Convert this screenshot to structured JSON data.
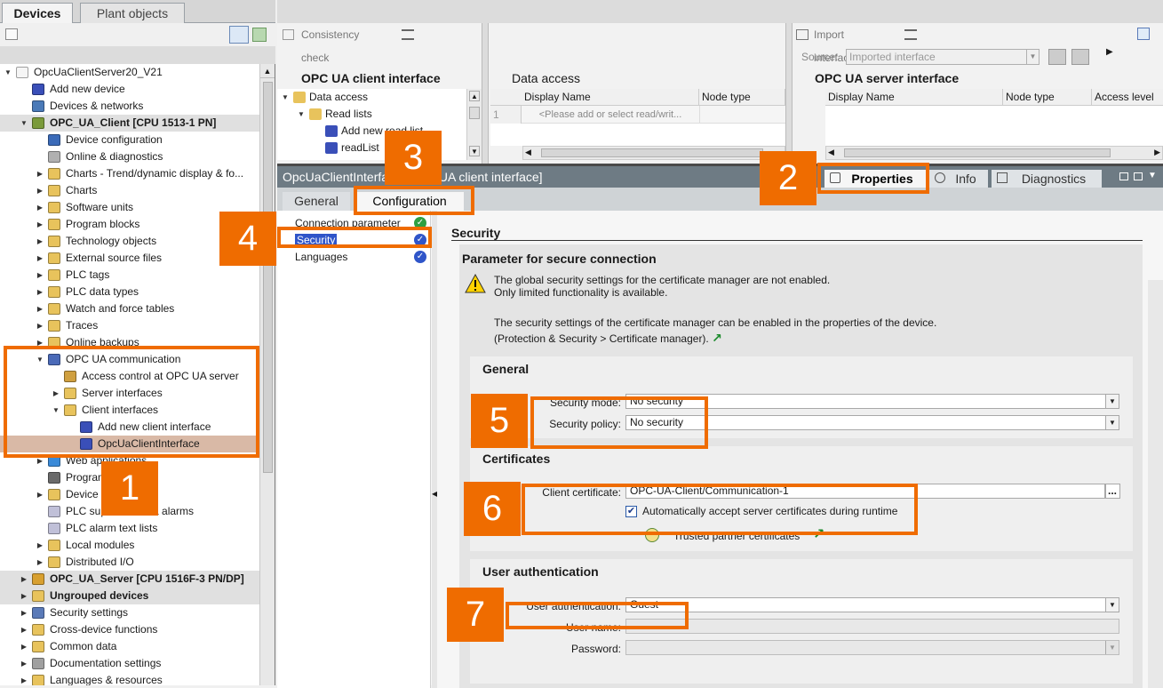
{
  "left_panel": {
    "tabs": [
      "Devices",
      "Plant objects"
    ],
    "tree": [
      {
        "label": "OpcUaClientServer20_V21",
        "indent": 0,
        "state": "open",
        "icon": "project-icon",
        "color": "#f5f5f5"
      },
      {
        "label": "Add new device",
        "indent": 1,
        "state": "none",
        "icon": "add-device-icon",
        "color": "#3a4fb8"
      },
      {
        "label": "Devices & networks",
        "indent": 1,
        "state": "none",
        "icon": "network-icon",
        "color": "#4a7ab8"
      },
      {
        "label": "OPC_UA_Client [CPU 1513-1 PN]",
        "indent": 1,
        "state": "open",
        "icon": "plc-icon",
        "color": "#7a9a3a",
        "band": true
      },
      {
        "label": "Device configuration",
        "indent": 2,
        "state": "none",
        "icon": "device-config-icon",
        "color": "#3a6ab8"
      },
      {
        "label": "Online & diagnostics",
        "indent": 2,
        "state": "none",
        "icon": "online-diagnostics-icon",
        "color": "#b0b0b0"
      },
      {
        "label": "Charts - Trend/dynamic display & fo...",
        "indent": 2,
        "state": "closed",
        "icon": "folder-icon",
        "color": "#e8c35c"
      },
      {
        "label": "Charts",
        "indent": 2,
        "state": "closed",
        "icon": "folder-icon",
        "color": "#e8c35c"
      },
      {
        "label": "Software units",
        "indent": 2,
        "state": "closed",
        "icon": "folder-icon",
        "color": "#e8c35c"
      },
      {
        "label": "Program blocks",
        "indent": 2,
        "state": "closed",
        "icon": "folder-icon",
        "color": "#e8c35c"
      },
      {
        "label": "Technology objects",
        "indent": 2,
        "state": "closed",
        "icon": "folder-icon",
        "color": "#e8c35c"
      },
      {
        "label": "External source files",
        "indent": 2,
        "state": "closed",
        "icon": "folder-icon",
        "color": "#e8c35c"
      },
      {
        "label": "PLC tags",
        "indent": 2,
        "state": "closed",
        "icon": "folder-icon",
        "color": "#e8c35c"
      },
      {
        "label": "PLC data types",
        "indent": 2,
        "state": "closed",
        "icon": "folder-icon",
        "color": "#e8c35c"
      },
      {
        "label": "Watch and force tables",
        "indent": 2,
        "state": "closed",
        "icon": "folder-icon",
        "color": "#e8c35c"
      },
      {
        "label": "Traces",
        "indent": 2,
        "state": "closed",
        "icon": "folder-icon",
        "color": "#e8c35c"
      },
      {
        "label": "Online backups",
        "indent": 2,
        "state": "closed",
        "icon": "folder-icon",
        "color": "#e8c35c"
      },
      {
        "label": "OPC UA communication",
        "indent": 2,
        "state": "open",
        "icon": "opc-ua-icon",
        "color": "#4a6ab8"
      },
      {
        "label": "Access control at OPC UA server",
        "indent": 3,
        "state": "none",
        "icon": "users-icon",
        "color": "#d0a040"
      },
      {
        "label": "Server interfaces",
        "indent": 3,
        "state": "closed",
        "icon": "folder-icon",
        "color": "#e8c35c"
      },
      {
        "label": "Client interfaces",
        "indent": 3,
        "state": "open",
        "icon": "folder-icon",
        "color": "#e8c35c"
      },
      {
        "label": "Add new client interface",
        "indent": 4,
        "state": "none",
        "icon": "add-interface-icon",
        "color": "#3a4fb8"
      },
      {
        "label": "OpcUaClientInterface",
        "indent": 4,
        "state": "none",
        "icon": "interface-icon",
        "color": "#3a4fb8",
        "selected": true
      },
      {
        "label": "Web applications",
        "indent": 2,
        "state": "closed",
        "icon": "web-icon",
        "color": "#3a8ad8"
      },
      {
        "label": "Program info",
        "indent": 2,
        "state": "none",
        "icon": "program-info-icon",
        "color": "#6a6a6a"
      },
      {
        "label": "Device proxy data",
        "indent": 2,
        "state": "closed",
        "icon": "folder-icon",
        "color": "#e8c35c"
      },
      {
        "label": "PLC supervisions & alarms",
        "indent": 2,
        "state": "none",
        "icon": "alarm-icon",
        "color": "#c0c0d8"
      },
      {
        "label": "PLC alarm text lists",
        "indent": 2,
        "state": "none",
        "icon": "text-list-icon",
        "color": "#c0c0d8"
      },
      {
        "label": "Local modules",
        "indent": 2,
        "state": "closed",
        "icon": "folder-icon",
        "color": "#e8c35c"
      },
      {
        "label": "Distributed I/O",
        "indent": 2,
        "state": "closed",
        "icon": "folder-icon",
        "color": "#e8c35c"
      },
      {
        "label": "OPC_UA_Server [CPU 1516F-3 PN/DP]",
        "indent": 1,
        "state": "closed",
        "icon": "plc-icon",
        "color": "#d8a030",
        "band": true
      },
      {
        "label": "Ungrouped devices",
        "indent": 1,
        "state": "closed",
        "icon": "folder-icon",
        "color": "#e8c35c",
        "band": true
      },
      {
        "label": "Security settings",
        "indent": 1,
        "state": "closed",
        "icon": "security-icon",
        "color": "#5a7ab8"
      },
      {
        "label": "Cross-device functions",
        "indent": 1,
        "state": "closed",
        "icon": "folder-icon",
        "color": "#e8c35c"
      },
      {
        "label": "Common data",
        "indent": 1,
        "state": "closed",
        "icon": "folder-icon",
        "color": "#e8c35c"
      },
      {
        "label": "Documentation settings",
        "indent": 1,
        "state": "closed",
        "icon": "doc-icon",
        "color": "#a0a0a0"
      },
      {
        "label": "Languages & resources",
        "indent": 1,
        "state": "closed",
        "icon": "folder-icon",
        "color": "#e8c35c"
      }
    ]
  },
  "editor": {
    "consistency_check": "Consistency check",
    "import_interface": "Import interface",
    "source_label": "Source:",
    "source_value": "Imported interface",
    "client_interface_title": "OPC UA client interface",
    "data_access_title": "Data access",
    "server_interface_title": "OPC UA server interface",
    "client_tree": [
      {
        "label": "Data access",
        "indent": 0
      },
      {
        "label": "Read lists",
        "indent": 1
      },
      {
        "label": "Add new read list",
        "indent": 2
      },
      {
        "label": "readList",
        "indent": 2
      }
    ],
    "data_access_columns": [
      "Display Name",
      "Node type"
    ],
    "data_access_row_index": "1",
    "data_access_placeholder": "<Please add or select read/writ...",
    "server_columns": [
      "Display Name",
      "Node type",
      "Access level"
    ]
  },
  "properties": {
    "title": "OpcUaClientInterface [OPC UA client interface]",
    "tabs": [
      "Properties",
      "Info",
      "Diagnostics"
    ],
    "subtabs": [
      "General",
      "Configuration"
    ],
    "nav": [
      {
        "label": "Connection parameter",
        "status": "ok",
        "color": "#2ea043"
      },
      {
        "label": "Security",
        "status": "info",
        "color": "#2f55c9",
        "selected": true
      },
      {
        "label": "Languages",
        "status": "info",
        "color": "#2f55c9"
      }
    ],
    "security_heading": "Security",
    "secure_param_title": "Parameter for secure connection",
    "warning_line1": "The global security settings for the certificate manager are not enabled.",
    "warning_line2": "Only limited functionality is available.",
    "info_line1": "The security settings of the certificate manager can be enabled in the properties of the device.",
    "info_line2": "(Protection & Security > Certificate manager).",
    "general_title": "General",
    "security_mode_label": "Security mode:",
    "security_mode_value": "No security",
    "security_policy_label": "Security policy:",
    "security_policy_value": "No security",
    "certificates_title": "Certificates",
    "client_cert_label": "Client certificate:",
    "client_cert_value": "OPC-UA-Client/Communication-1",
    "browse_label": "...",
    "auto_accept_label": "Automatically accept server certificates during runtime",
    "auto_accept_checked": true,
    "trusted_label": "Trusted partner certificates",
    "user_auth_title": "User authentication",
    "user_auth_label": "User authentication:",
    "user_auth_value": "Guest",
    "user_name_label": "User name:",
    "password_label": "Password:"
  },
  "callouts": [
    "1",
    "2",
    "3",
    "4",
    "5",
    "6",
    "7"
  ],
  "colors": {
    "accent": "#ef6c00",
    "title_bar": "#6e7b84",
    "ok": "#2ea043",
    "info": "#2f55c9"
  }
}
